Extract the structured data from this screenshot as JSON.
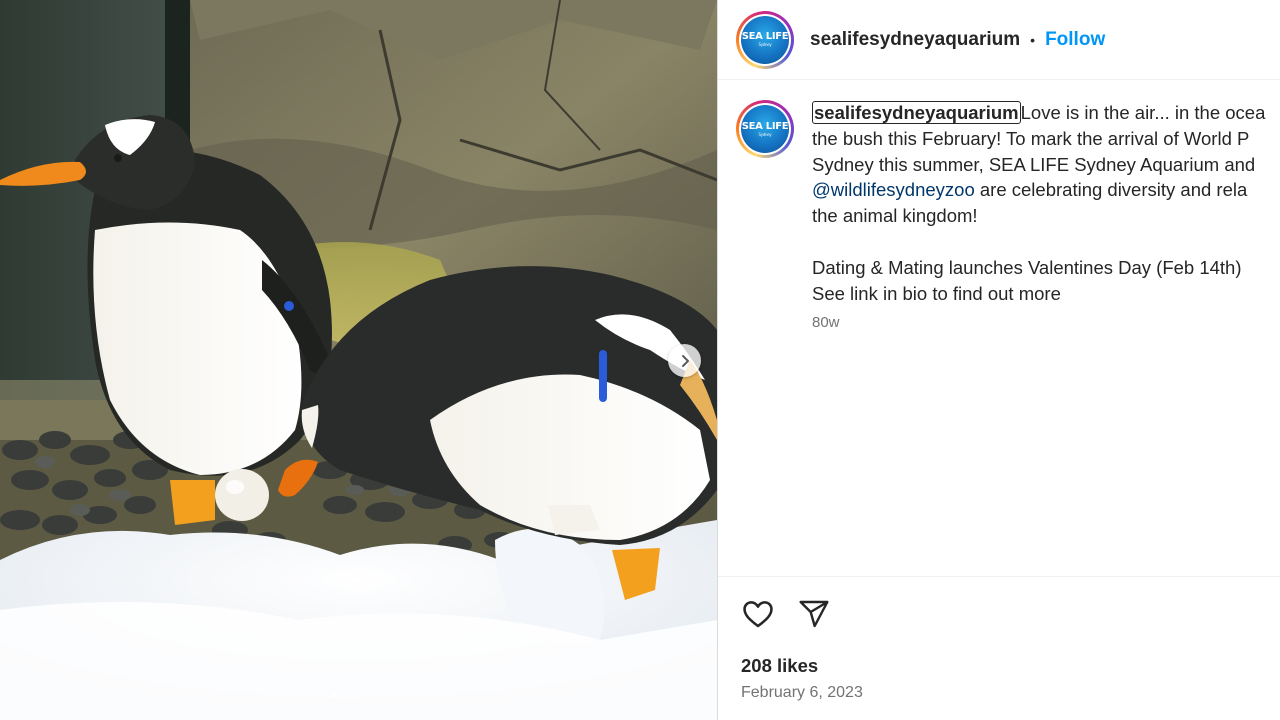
{
  "post": {
    "username": "sealifesydneyaquarium",
    "header_separator": "•",
    "follow_label": "Follow",
    "avatar_logo_text": "SEA LIFE",
    "avatar_logo_subtext": "Sydney"
  },
  "caption": {
    "username": "sealifesydneyaquarium",
    "line1_text": "Love is in the air... in the ocea",
    "line2": "the bush this February! To mark the arrival of World P",
    "line3": "Sydney this summer, SEA LIFE Sydney Aquarium and",
    "line4_mention": "@wildlifesydneyzoo",
    "line4_rest": " are celebrating diversity and rela",
    "line5": "the animal kingdom!",
    "line6": "Dating & Mating launches Valentines Day (Feb 14th)",
    "line7": "See link in bio to find out more",
    "timestamp": "80w"
  },
  "footer": {
    "likes": "208 likes",
    "date": "February 6, 2023"
  },
  "media": {
    "carousel_count": 3,
    "carousel_active_index": 0,
    "next_icon": "chevron-right-icon",
    "content": "photo-two-gentoo-penguins-with-egg"
  },
  "icons": {
    "like": "heart-icon",
    "share": "paper-plane-icon"
  },
  "colors": {
    "follow": "#0095f6",
    "mention": "#00376b",
    "muted_text": "#737373",
    "text": "#262626"
  }
}
